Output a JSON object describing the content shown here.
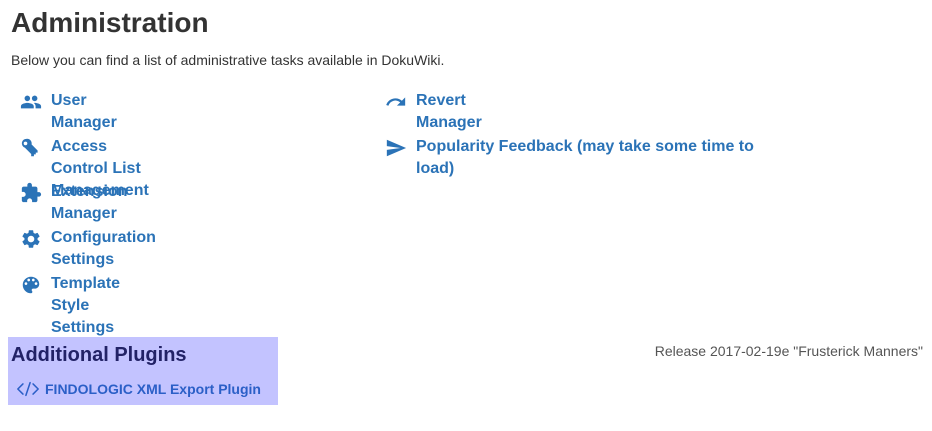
{
  "page": {
    "title": "Administration",
    "intro": "Below you can find a list of administrative tasks available in DokuWiki."
  },
  "tasks": {
    "user_manager": "User Manager",
    "acl": "Access Control List Management",
    "extension_manager": "Extension Manager",
    "config": "Configuration Settings",
    "template_style": "Template Style Settings",
    "revert_manager": "Revert Manager",
    "popularity_line1": "Popularity Feedback (may take some time to",
    "popularity_line2": "load)"
  },
  "plugins": {
    "heading": "Additional Plugins",
    "items": [
      {
        "label": "FINDOLOGIC XML Export Plugin",
        "icon": "code-icon"
      }
    ]
  },
  "footer": {
    "release": "Release 2017-02-19e \"Frusterick Manners\""
  },
  "colors": {
    "link": "#2b73b7",
    "plugins_bg": "#c3c3ff",
    "plugins_heading": "#222266"
  }
}
